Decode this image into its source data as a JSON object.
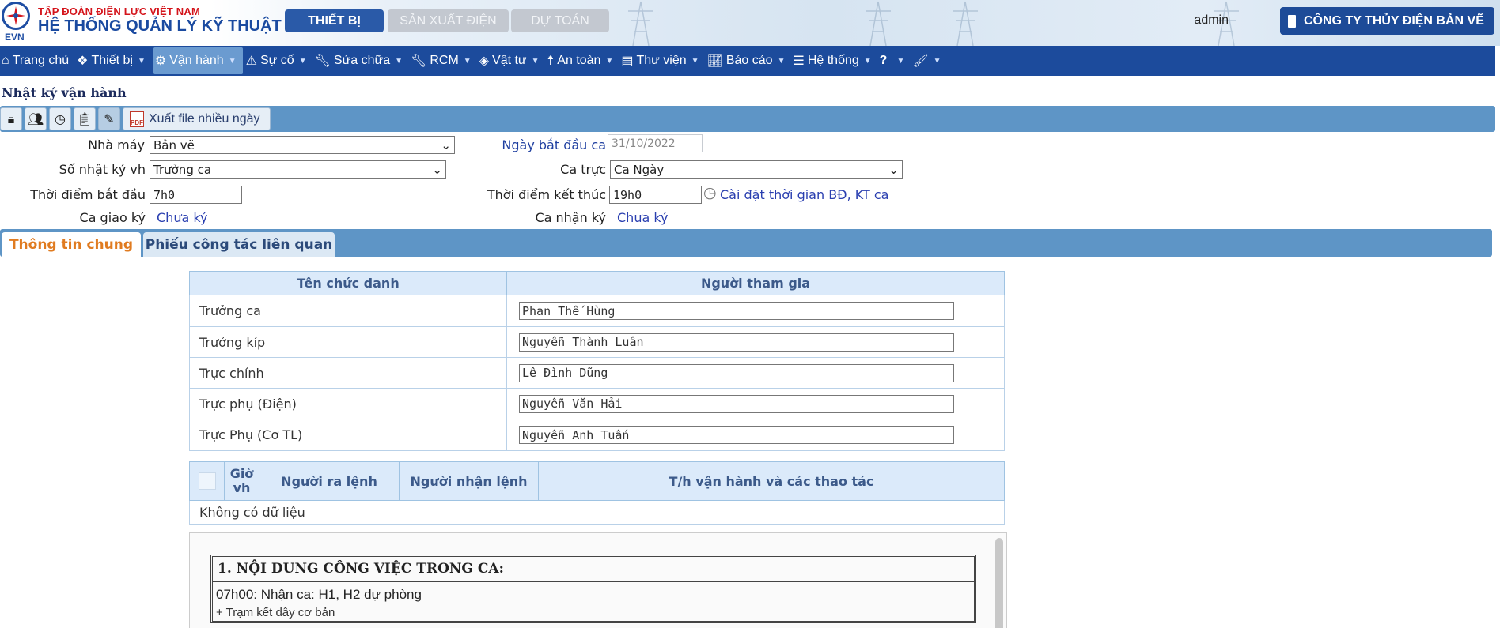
{
  "header": {
    "logo_text": "EVN",
    "org_name": "TẬP ĐOÀN ĐIỆN LỰC VIỆT NAM",
    "system_name": "HỆ THỐNG QUẢN LÝ KỸ THUẬT",
    "modules": [
      "THIẾT BỊ",
      "SẢN XUẤT ĐIỆN",
      "DỰ TOÁN"
    ],
    "user": "admin",
    "company": "CÔNG TY THỦY ĐIỆN BẢN VẼ"
  },
  "menu": [
    {
      "label": "Trang chủ",
      "icon": "home-icon"
    },
    {
      "label": "Thiết bị",
      "icon": "cubes-icon"
    },
    {
      "label": "Vận hành",
      "icon": "gears-icon"
    },
    {
      "label": "Sự cố",
      "icon": "warning-icon"
    },
    {
      "label": "Sửa chữa",
      "icon": "wrench-icon"
    },
    {
      "label": "RCM",
      "icon": "wrench-icon"
    },
    {
      "label": "Vật tư",
      "icon": "cube-icon"
    },
    {
      "label": "An toàn",
      "icon": "person-icon"
    },
    {
      "label": "Thư viện",
      "icon": "book-icon"
    },
    {
      "label": "Báo cáo",
      "icon": "chart-icon"
    },
    {
      "label": "Hệ thống",
      "icon": "list-icon"
    },
    {
      "label": "?",
      "icon": ""
    },
    {
      "label": "",
      "icon": "brush-icon"
    }
  ],
  "page_title": "Nhật ký vận hành",
  "toolbar": {
    "export_label": "Xuất file nhiều ngày"
  },
  "form": {
    "plant_label": "Nhà máy",
    "plant_value": "Bản vẽ",
    "start_date_label": "Ngày bắt đầu ca",
    "start_date_value": "31/10/2022",
    "log_label": "Số nhật ký vh",
    "log_value": "Trưởng ca",
    "shift_label": "Ca trực",
    "shift_value": "Ca Ngày",
    "start_time_label": "Thời điểm bắt đầu",
    "start_time_value": "7h0",
    "end_time_label": "Thời điểm kết thúc",
    "end_time_value": "19h0",
    "time_setting_link": "Cài đặt thời gian BĐ, KT ca",
    "handover_label": "Ca giao ký",
    "handover_value": "Chưa ký",
    "receive_label": "Ca nhận ký",
    "receive_value": "Chưa ký"
  },
  "tabs": [
    "Thông tin chung",
    "Phiếu công tác liên quan"
  ],
  "staff_table": {
    "headers": [
      "Tên chức danh",
      "Người tham gia"
    ],
    "rows": [
      {
        "role": "Trưởng ca",
        "person": "Phan Thế Hùng"
      },
      {
        "role": "Trưởng kíp",
        "person": "Nguyễn Thành Luân"
      },
      {
        "role": "Trực chính",
        "person": "Lê Đình Dũng"
      },
      {
        "role": "Trực phụ (Điện)",
        "person": "Nguyễn Văn Hải"
      },
      {
        "role": "Trực Phụ (Cơ TL)",
        "person": "Nguyễn Anh Tuấn"
      }
    ]
  },
  "ops_table": {
    "headers": [
      "Giờ vh",
      "Người ra lệnh",
      "Người nhận lệnh",
      "T/h vận hành và các thao tác"
    ],
    "empty": "Không có dữ liệu"
  },
  "editor": {
    "heading": "1. NỘI DUNG CÔNG VIỆC TRONG CA:",
    "line1": "07h00: Nhận ca: H1, H2 dự phòng",
    "line2": "+ Trạm kết dây cơ bản"
  }
}
